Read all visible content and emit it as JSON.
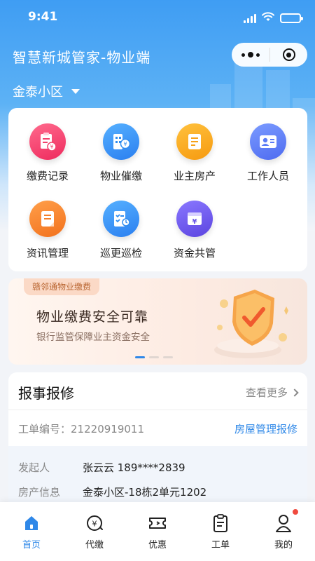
{
  "status_bar": {
    "time": "9:41"
  },
  "header": {
    "title": "智慧新城管家-物业端",
    "community": "金泰小区"
  },
  "menu": [
    {
      "label": "缴费记录",
      "icon": "receipt-icon",
      "color": "#f2426d"
    },
    {
      "label": "物业催缴",
      "icon": "building-payment-icon",
      "color": "#2f8cf0"
    },
    {
      "label": "业主房产",
      "icon": "property-document-icon",
      "color": "#f7a21a"
    },
    {
      "label": "工作人员",
      "icon": "staff-card-icon",
      "color": "#5b7cf6"
    },
    {
      "label": "资讯管理",
      "icon": "news-icon",
      "color": "#f4802a"
    },
    {
      "label": "巡更巡检",
      "icon": "inspection-checklist-icon",
      "color": "#2f8cf0"
    },
    {
      "label": "资金共管",
      "icon": "fund-box-icon",
      "color": "#6b58e6"
    }
  ],
  "banner": {
    "tag": "赣邻通物业缴费",
    "headline": "物业缴费安全可靠",
    "subline": "银行监管保障业主资金安全"
  },
  "repair": {
    "title": "报事报修",
    "more": "查看更多",
    "order_label": "工单编号：",
    "order_number": "21220919011",
    "order_type": "房屋管理报修",
    "rows": [
      {
        "key": "发起人",
        "value": "张云云 189****2839"
      },
      {
        "key": "房产信息",
        "value": "金泰小区-18栋2单元1202"
      }
    ]
  },
  "tabbar": [
    {
      "label": "首页",
      "icon": "home-icon",
      "active": true
    },
    {
      "label": "代缴",
      "icon": "yuan-coin-icon",
      "active": false
    },
    {
      "label": "优惠",
      "icon": "ticket-icon",
      "active": false
    },
    {
      "label": "工单",
      "icon": "clipboard-icon",
      "active": false
    },
    {
      "label": "我的",
      "icon": "user-icon",
      "active": false
    }
  ],
  "colors": {
    "primary": "#2f88e8",
    "badge": "#f04a3e"
  }
}
